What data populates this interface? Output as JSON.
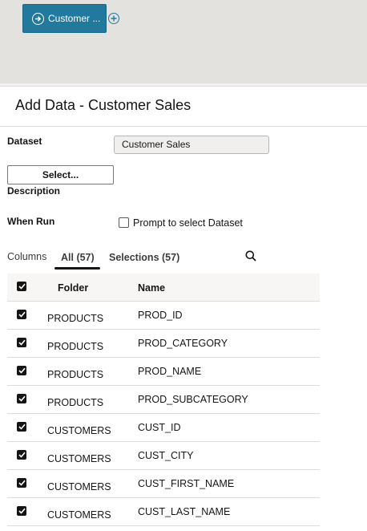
{
  "canvas": {
    "node_label": "Customer ...",
    "accent": "#21799e"
  },
  "panel": {
    "title": "Add Data - Customer Sales"
  },
  "dataset": {
    "label": "Dataset",
    "value": "Customer Sales",
    "select_button": "Select..."
  },
  "description": {
    "label": "Description"
  },
  "when_run": {
    "label": "When Run",
    "checkbox_label": "Prompt to select Dataset",
    "checked": false
  },
  "columns": {
    "label": "Columns",
    "tabs": [
      {
        "label": "All (57)",
        "active": true
      },
      {
        "label": "Selections (57)",
        "active": false
      }
    ],
    "headers": {
      "folder": "Folder",
      "name": "Name"
    },
    "rows": [
      {
        "folder": "PRODUCTS",
        "name": "PROD_ID",
        "checked": true
      },
      {
        "folder": "PRODUCTS",
        "name": "PROD_CATEGORY",
        "checked": true
      },
      {
        "folder": "PRODUCTS",
        "name": "PROD_NAME",
        "checked": true
      },
      {
        "folder": "PRODUCTS",
        "name": "PROD_SUBCATEGORY",
        "checked": true
      },
      {
        "folder": "CUSTOMERS",
        "name": "CUST_ID",
        "checked": true
      },
      {
        "folder": "CUSTOMERS",
        "name": "CUST_CITY",
        "checked": true
      },
      {
        "folder": "CUSTOMERS",
        "name": "CUST_FIRST_NAME",
        "checked": true
      },
      {
        "folder": "CUSTOMERS",
        "name": "CUST_LAST_NAME",
        "checked": true
      }
    ]
  }
}
